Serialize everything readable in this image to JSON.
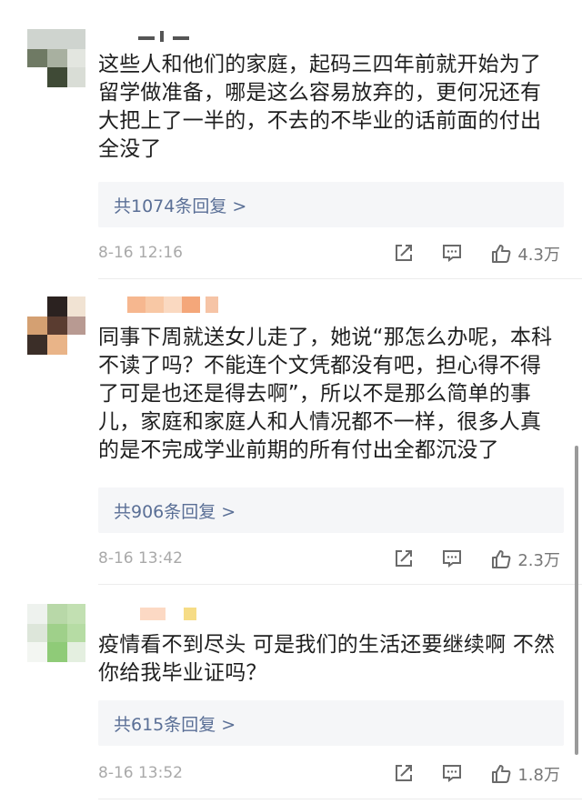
{
  "comments": [
    {
      "text": "这些人和他们的家庭，起码三四年前就开始为了留学做准备，哪是这么容易放弃的，更何况还有大把上了一半的，不去的不毕业的话前面的付出全没了",
      "replies_label": "共1074条回复 >",
      "timestamp": "8-16 12:16",
      "likes": "4.3万"
    },
    {
      "text": "同事下周就送女儿走了，她说“那怎么办呢，本科不读了吗？不能连个文凭都没有吧，担心得不得了可是也还是得去啊”，所以不是那么简单的事儿，家庭和家庭人和人情况都不一样，很多人真的是不完成学业前期的所有付出全都沉没了",
      "replies_label": "共906条回复 >",
      "timestamp": "8-16 13:42",
      "likes": "2.3万"
    },
    {
      "text": "疫情看不到尽头 可是我们的生活还要继续啊 不然你给我毕业证吗？",
      "replies_label": "共615条回复 >",
      "timestamp": "8-16 13:52",
      "likes": "1.8万"
    }
  ],
  "icons": {
    "share": "share-icon",
    "comment": "comment-icon",
    "like": "thumbs-up-icon"
  },
  "colors": {
    "reply_link": "#5a6f96",
    "timestamp": "#a9a9a9",
    "reply_bg": "#f5f6f8"
  }
}
